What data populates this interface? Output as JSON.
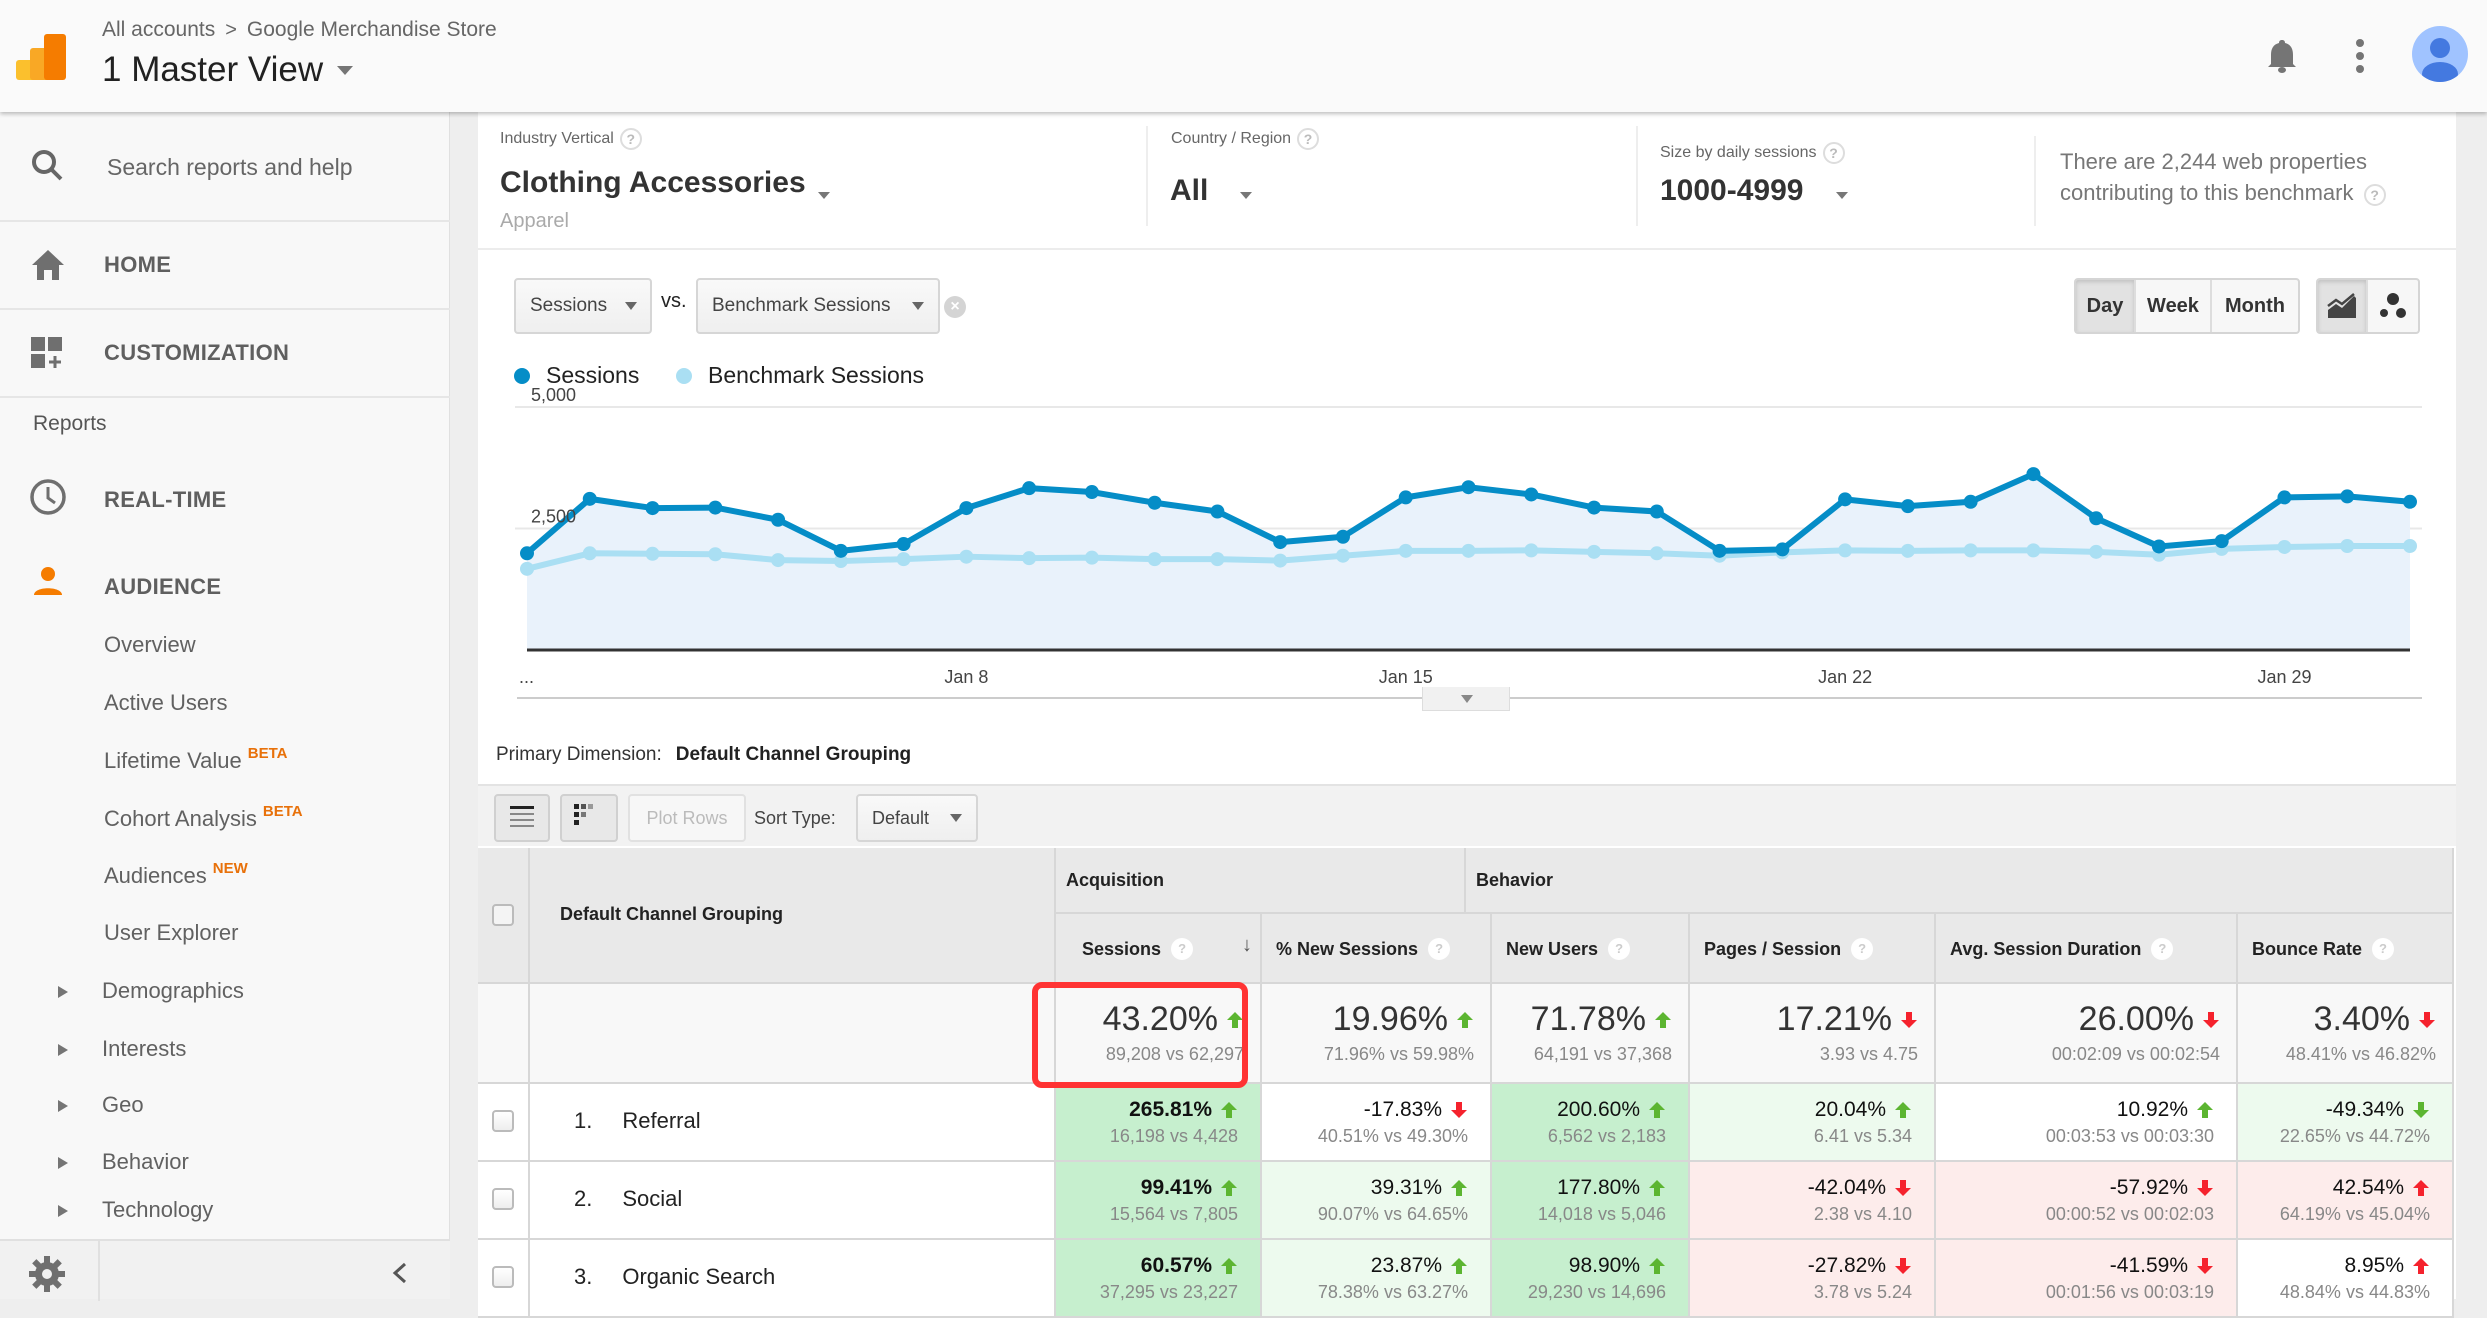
{
  "header": {
    "breadcrumb": [
      "All accounts",
      "Google Merchandise Store"
    ],
    "breadcrumb_separator": ">",
    "view_title": "1 Master View",
    "icons": [
      "analytics-logo",
      "bell-icon",
      "more-vert-icon",
      "account-avatar"
    ]
  },
  "sidebar": {
    "search_placeholder": "Search reports and help",
    "home": "HOME",
    "customization": "CUSTOMIZATION",
    "reports_heading": "Reports",
    "realtime": "REAL-TIME",
    "audience": "AUDIENCE",
    "audience_items": [
      {
        "label": "Overview",
        "badge": ""
      },
      {
        "label": "Active Users",
        "badge": ""
      },
      {
        "label": "Lifetime Value",
        "badge": "BETA"
      },
      {
        "label": "Cohort Analysis",
        "badge": "BETA"
      },
      {
        "label": "Audiences",
        "badge": "NEW"
      },
      {
        "label": "User Explorer",
        "badge": ""
      }
    ],
    "expandable_items": [
      "Demographics",
      "Interests",
      "Geo",
      "Behavior",
      "Technology"
    ],
    "accent_color": "#f57c00"
  },
  "filters": {
    "industry": {
      "label": "Industry Vertical",
      "value": "Clothing Accessories",
      "sub": "Apparel"
    },
    "country": {
      "label": "Country / Region",
      "value": "All"
    },
    "size": {
      "label": "Size by daily sessions",
      "value": "1000-4999"
    },
    "note": "There are 2,244 web properties contributing to this benchmark"
  },
  "chart_controls": {
    "metric": "Sessions",
    "vs": "vs.",
    "compare_metric": "Benchmark Sessions",
    "granularity": [
      "Day",
      "Week",
      "Month"
    ],
    "granularity_active": "Day",
    "chart_types": [
      "line-chart-icon",
      "motion-chart-icon"
    ]
  },
  "chart_data": {
    "type": "line",
    "title": "",
    "xlabel": "",
    "ylabel": "",
    "ylim": [
      0,
      5000
    ],
    "yticks": [
      {
        "value": 5000,
        "label": "5,000"
      },
      {
        "value": 2500,
        "label": "2,500"
      }
    ],
    "x_tick_labels": [
      {
        "index": 0,
        "label": "..."
      },
      {
        "index": 7,
        "label": "Jan 8"
      },
      {
        "index": 14,
        "label": "Jan 15"
      },
      {
        "index": 21,
        "label": "Jan 22"
      },
      {
        "index": 28,
        "label": "Jan 29"
      }
    ],
    "x": [
      "Jan 1",
      "Jan 2",
      "Jan 3",
      "Jan 4",
      "Jan 5",
      "Jan 6",
      "Jan 7",
      "Jan 8",
      "Jan 9",
      "Jan 10",
      "Jan 11",
      "Jan 12",
      "Jan 13",
      "Jan 14",
      "Jan 15",
      "Jan 16",
      "Jan 17",
      "Jan 18",
      "Jan 19",
      "Jan 20",
      "Jan 21",
      "Jan 22",
      "Jan 23",
      "Jan 24",
      "Jan 25",
      "Jan 26",
      "Jan 27",
      "Jan 28",
      "Jan 29",
      "Jan 30",
      "Jan 31"
    ],
    "series": [
      {
        "name": "Sessions",
        "color": "#058dc7",
        "values": [
          1990,
          3110,
          2920,
          2930,
          2680,
          2040,
          2180,
          2920,
          3330,
          3250,
          3030,
          2850,
          2220,
          2330,
          3140,
          3350,
          3200,
          2930,
          2850,
          2040,
          2070,
          3100,
          2960,
          3050,
          3620,
          2710,
          2130,
          2240,
          3140,
          3160,
          3050
        ]
      },
      {
        "name": "Benchmark Sessions",
        "color": "#aadff3",
        "values": [
          1670,
          1990,
          1980,
          1970,
          1850,
          1830,
          1870,
          1920,
          1890,
          1900,
          1870,
          1870,
          1840,
          1940,
          2040,
          2040,
          2050,
          2020,
          1990,
          1940,
          2010,
          2050,
          2040,
          2050,
          2050,
          2020,
          1960,
          2080,
          2120,
          2140,
          2140
        ]
      }
    ],
    "grid": true,
    "legend": "top-left"
  },
  "table": {
    "primary_dimension_label": "Primary Dimension:",
    "primary_dimension_value": "Default Channel Grouping",
    "plot_rows": "Plot Rows",
    "sort_type_label": "Sort Type:",
    "sort_type_value": "Default",
    "dimension_header": "Default Channel Grouping",
    "groups": [
      "Acquisition",
      "Behavior"
    ],
    "columns": [
      "Sessions",
      "% New Sessions",
      "New Users",
      "Pages / Session",
      "Avg. Session Duration",
      "Bounce Rate"
    ],
    "totals": [
      {
        "value": "43.20%",
        "sub": "89,208 vs 62,297",
        "dir": "up",
        "good": true
      },
      {
        "value": "19.96%",
        "sub": "71.96% vs 59.98%",
        "dir": "up",
        "good": true
      },
      {
        "value": "71.78%",
        "sub": "64,191 vs 37,368",
        "dir": "up",
        "good": true
      },
      {
        "value": "17.21%",
        "sub": "3.93 vs 4.75",
        "dir": "down",
        "good": false
      },
      {
        "value": "26.00%",
        "sub": "00:02:09 vs 00:02:54",
        "dir": "down",
        "good": false
      },
      {
        "value": "3.40%",
        "sub": "48.41% vs 46.82%",
        "dir": "down",
        "good": false
      }
    ],
    "rows": [
      {
        "index": "1.",
        "name": "Referral",
        "cells": [
          {
            "value": "265.81%",
            "sub": "16,198 vs 4,428",
            "dir": "up",
            "good": true,
            "bg": "green-strong"
          },
          {
            "value": "-17.83%",
            "sub": "40.51% vs 49.30%",
            "dir": "down",
            "good": false,
            "bg": "white"
          },
          {
            "value": "200.60%",
            "sub": "6,562 vs 2,183",
            "dir": "up",
            "good": true,
            "bg": "green-strong"
          },
          {
            "value": "20.04%",
            "sub": "6.41 vs 5.34",
            "dir": "up",
            "good": true,
            "bg": "green-light"
          },
          {
            "value": "10.92%",
            "sub": "00:03:53 vs 00:03:30",
            "dir": "up",
            "good": true,
            "bg": "white"
          },
          {
            "value": "-49.34%",
            "sub": "22.65% vs 44.72%",
            "dir": "down",
            "good": true,
            "bg": "green-light"
          }
        ]
      },
      {
        "index": "2.",
        "name": "Social",
        "cells": [
          {
            "value": "99.41%",
            "sub": "15,564 vs 7,805",
            "dir": "up",
            "good": true,
            "bg": "green-strong"
          },
          {
            "value": "39.31%",
            "sub": "90.07% vs 64.65%",
            "dir": "up",
            "good": true,
            "bg": "green-light"
          },
          {
            "value": "177.80%",
            "sub": "14,018 vs 5,046",
            "dir": "up",
            "good": true,
            "bg": "green-strong"
          },
          {
            "value": "-42.04%",
            "sub": "2.38 vs 4.10",
            "dir": "down",
            "good": false,
            "bg": "red-light"
          },
          {
            "value": "-57.92%",
            "sub": "00:00:52 vs 00:02:03",
            "dir": "down",
            "good": false,
            "bg": "red-light"
          },
          {
            "value": "42.54%",
            "sub": "64.19% vs 45.04%",
            "dir": "up",
            "good": false,
            "bg": "red-light"
          }
        ]
      },
      {
        "index": "3.",
        "name": "Organic Search",
        "cells": [
          {
            "value": "60.57%",
            "sub": "37,295 vs 23,227",
            "dir": "up",
            "good": true,
            "bg": "green-strong"
          },
          {
            "value": "23.87%",
            "sub": "78.38% vs 63.27%",
            "dir": "up",
            "good": true,
            "bg": "green-light"
          },
          {
            "value": "98.90%",
            "sub": "29,230 vs 14,696",
            "dir": "up",
            "good": true,
            "bg": "green-strong"
          },
          {
            "value": "-27.82%",
            "sub": "3.78 vs 5.24",
            "dir": "down",
            "good": false,
            "bg": "red-light"
          },
          {
            "value": "-41.59%",
            "sub": "00:01:56 vs 00:03:19",
            "dir": "down",
            "good": false,
            "bg": "red-light"
          },
          {
            "value": "8.95%",
            "sub": "48.84% vs 44.83%",
            "dir": "up",
            "good": false,
            "bg": "white"
          }
        ]
      }
    ],
    "colors": {
      "good": "#5cb531",
      "bad": "#f5222d",
      "highlight": "#ff3333"
    }
  }
}
